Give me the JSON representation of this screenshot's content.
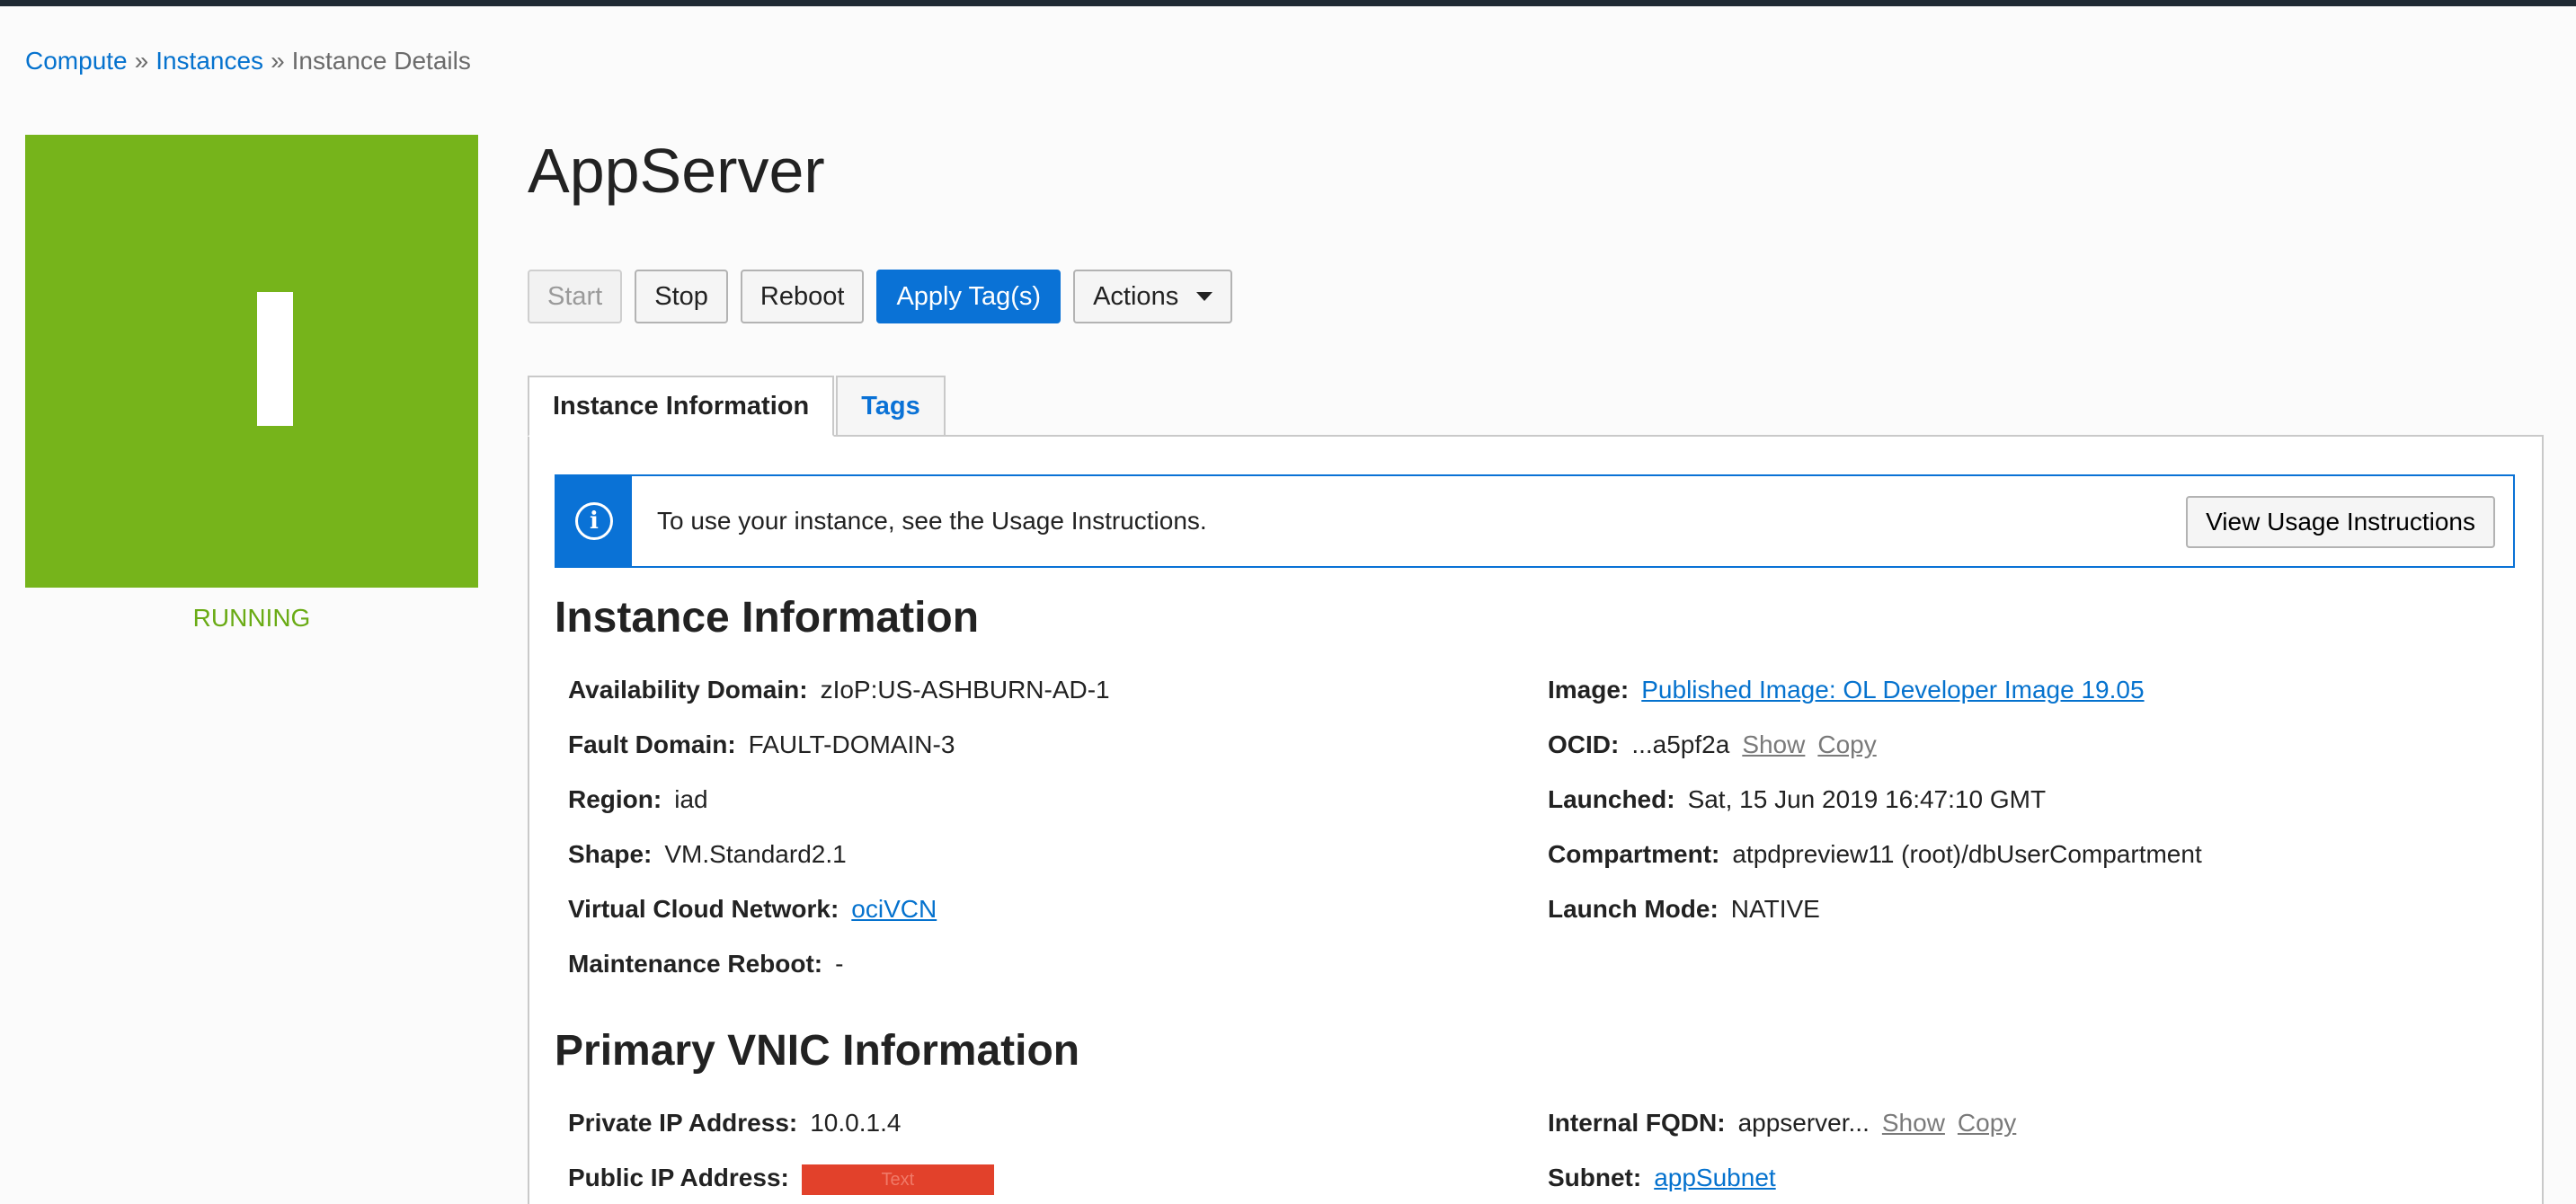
{
  "breadcrumb": {
    "items": [
      "Compute",
      "Instances",
      "Instance Details"
    ],
    "separator": "»"
  },
  "status": {
    "label": "RUNNING",
    "color": "#76b41b",
    "glyph": "I"
  },
  "title": "AppServer",
  "actions": {
    "start": "Start",
    "stop": "Stop",
    "reboot": "Reboot",
    "apply_tags": "Apply Tag(s)",
    "actions": "Actions"
  },
  "tabs": [
    {
      "label": "Instance Information"
    },
    {
      "label": "Tags"
    }
  ],
  "banner": {
    "message": "To use your instance, see the Usage Instructions.",
    "button": "View Usage Instructions"
  },
  "instance_info": {
    "title": "Instance Information",
    "left": [
      {
        "label": "Availability Domain:",
        "value": "zIoP:US-ASHBURN-AD-1"
      },
      {
        "label": "Fault Domain:",
        "value": "FAULT-DOMAIN-3"
      },
      {
        "label": "Region:",
        "value": "iad"
      },
      {
        "label": "Shape:",
        "value": "VM.Standard2.1"
      },
      {
        "label": "Virtual Cloud Network:",
        "value": "ociVCN"
      },
      {
        "label": "Maintenance Reboot:",
        "value": "-"
      }
    ],
    "right": [
      {
        "label": "Image:",
        "value": "Published Image: OL Developer Image 19.05"
      },
      {
        "label": "OCID:",
        "value": "...a5pf2a",
        "show": "Show",
        "copy": "Copy"
      },
      {
        "label": "Launched:",
        "value": "Sat, 15 Jun 2019 16:47:10 GMT"
      },
      {
        "label": "Compartment:",
        "value": "atpdpreview11 (root)/dbUserCompartment"
      },
      {
        "label": "Launch Mode:",
        "value": "NATIVE"
      }
    ]
  },
  "vnic_info": {
    "title": "Primary VNIC Information",
    "left": [
      {
        "label": "Private IP Address:",
        "value": "10.0.1.4"
      },
      {
        "label": "Public IP Address:",
        "value": "Text"
      }
    ],
    "right": [
      {
        "label": "Internal FQDN:",
        "value": "appserver...",
        "show": "Show",
        "copy": "Copy"
      },
      {
        "label": "Subnet:",
        "value": "appSubnet"
      }
    ]
  }
}
